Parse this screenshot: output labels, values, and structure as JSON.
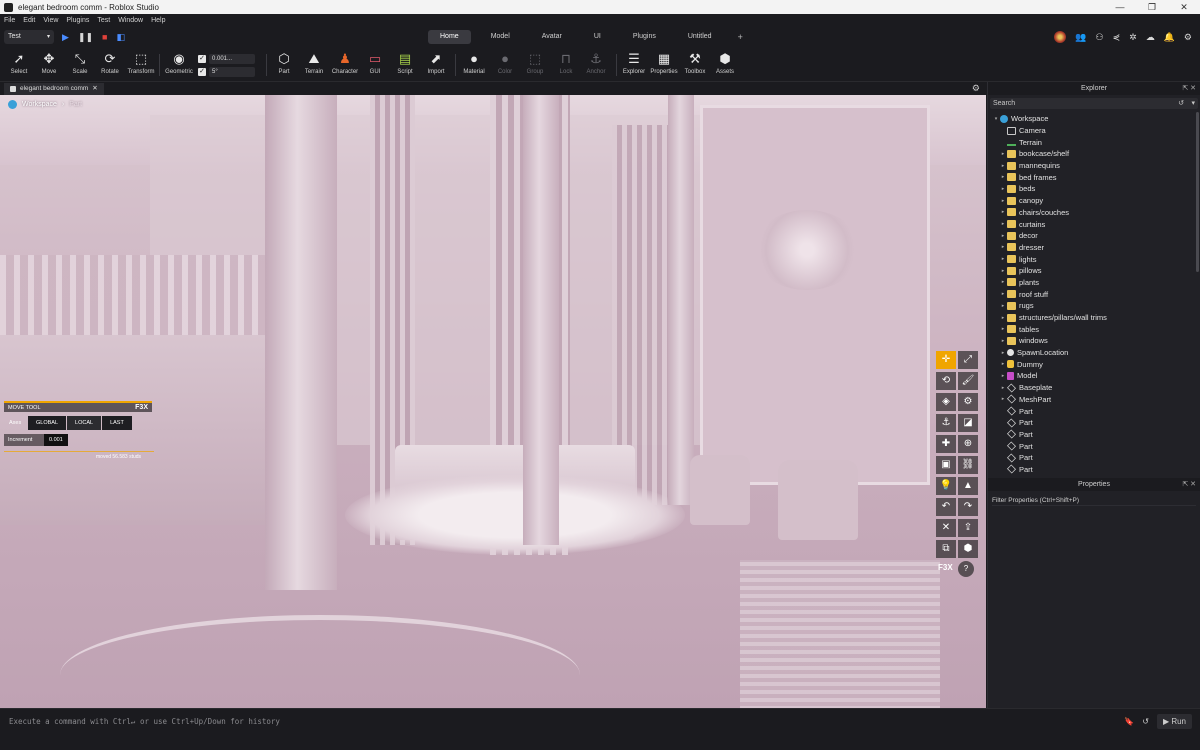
{
  "window": {
    "title": "elegant bedroom comm - Roblox Studio",
    "controls": [
      "—",
      "❐",
      "✕"
    ]
  },
  "menu": [
    "File",
    "Edit",
    "View",
    "Plugins",
    "Test",
    "Window",
    "Help"
  ],
  "quick": {
    "mode": "Test",
    "tabs": [
      {
        "label": "Home",
        "active": true
      },
      {
        "label": "Model",
        "active": false
      },
      {
        "label": "Avatar",
        "active": false
      },
      {
        "label": "UI",
        "active": false
      },
      {
        "label": "Plugins",
        "active": false
      },
      {
        "label": "Untitled",
        "active": false
      }
    ],
    "add_tab": "+"
  },
  "toolbar": {
    "tools": [
      {
        "label": "Select",
        "icon": "cursor-icon",
        "glyph": "➚"
      },
      {
        "label": "Move",
        "icon": "move-icon",
        "glyph": "✥"
      },
      {
        "label": "Scale",
        "icon": "scale-icon",
        "glyph": "⤡"
      },
      {
        "label": "Rotate",
        "icon": "rotate-icon",
        "glyph": "⟳"
      },
      {
        "label": "Transform",
        "icon": "transform-icon",
        "glyph": "⬚"
      },
      {
        "label": "Geometric",
        "icon": "geometric-icon",
        "glyph": "◉"
      }
    ],
    "snap_move": "0.001...",
    "snap_rotate": "5°",
    "insert": [
      {
        "label": "Part",
        "icon": "part-icon",
        "glyph": "⬡"
      },
      {
        "label": "Terrain",
        "icon": "terrain-icon",
        "glyph": "⛰"
      },
      {
        "label": "Character",
        "icon": "character-icon",
        "glyph": "♟"
      },
      {
        "label": "GUI",
        "icon": "gui-icon",
        "glyph": "▭"
      },
      {
        "label": "Script",
        "icon": "script-icon",
        "glyph": "▤"
      },
      {
        "label": "Import",
        "icon": "import-icon",
        "glyph": "⬈"
      }
    ],
    "appearance": [
      {
        "label": "Material",
        "icon": "material-icon",
        "glyph": "●",
        "dim": false
      },
      {
        "label": "Color",
        "icon": "color-icon",
        "glyph": "●",
        "dim": true
      },
      {
        "label": "Group",
        "icon": "group-icon",
        "glyph": "⬚",
        "dim": true
      },
      {
        "label": "Lock",
        "icon": "lock-icon",
        "glyph": "🔒",
        "dim": true
      },
      {
        "label": "Anchor",
        "icon": "anchor-icon",
        "glyph": "⚓",
        "dim": true
      }
    ],
    "panels": [
      {
        "label": "Explorer",
        "icon": "explorer-icon",
        "glyph": "☰"
      },
      {
        "label": "Properties",
        "icon": "properties-icon",
        "glyph": "▦"
      },
      {
        "label": "Toolbox",
        "icon": "toolbox-icon",
        "glyph": "⚒"
      },
      {
        "label": "Assets",
        "icon": "assets-icon",
        "glyph": "⬢"
      }
    ]
  },
  "document": {
    "tab": "elegant bedroom comm",
    "close": "✕"
  },
  "viewport": {
    "breadcrumb": {
      "root": "Workspace",
      "child": "Part"
    }
  },
  "f3x": {
    "title": "MOVE TOOL",
    "brand": "F3X",
    "axes_label": "Axes",
    "axes": [
      "GLOBAL",
      "LOCAL",
      "LAST"
    ],
    "increment_label": "Increment",
    "increment_value": "0.001",
    "moved_note": "moved 56.583 studs",
    "dock_brand": "F3X"
  },
  "explorer": {
    "title": "Explorer",
    "search_placeholder": "Search",
    "items": [
      {
        "label": "Workspace",
        "icon": "world",
        "depth": 0,
        "twisty": "▾"
      },
      {
        "label": "Camera",
        "icon": "camera",
        "depth": 1,
        "twisty": ""
      },
      {
        "label": "Terrain",
        "icon": "terrain",
        "depth": 1,
        "twisty": ""
      },
      {
        "label": "bookcase/shelf",
        "icon": "folder",
        "depth": 1,
        "twisty": "▸"
      },
      {
        "label": "mannequins",
        "icon": "folder",
        "depth": 1,
        "twisty": "▸"
      },
      {
        "label": "bed frames",
        "icon": "folder",
        "depth": 1,
        "twisty": "▸"
      },
      {
        "label": "beds",
        "icon": "folder",
        "depth": 1,
        "twisty": "▸"
      },
      {
        "label": "canopy",
        "icon": "folder",
        "depth": 1,
        "twisty": "▸"
      },
      {
        "label": "chairs/couches",
        "icon": "folder",
        "depth": 1,
        "twisty": "▸"
      },
      {
        "label": "curtains",
        "icon": "folder",
        "depth": 1,
        "twisty": "▸"
      },
      {
        "label": "decor",
        "icon": "folder",
        "depth": 1,
        "twisty": "▸"
      },
      {
        "label": "dresser",
        "icon": "folder",
        "depth": 1,
        "twisty": "▸"
      },
      {
        "label": "lights",
        "icon": "folder",
        "depth": 1,
        "twisty": "▸"
      },
      {
        "label": "pillows",
        "icon": "folder",
        "depth": 1,
        "twisty": "▸"
      },
      {
        "label": "plants",
        "icon": "folder",
        "depth": 1,
        "twisty": "▸"
      },
      {
        "label": "roof stuff",
        "icon": "folder",
        "depth": 1,
        "twisty": "▸"
      },
      {
        "label": "rugs",
        "icon": "folder",
        "depth": 1,
        "twisty": "▸"
      },
      {
        "label": "structures/pillars/wall trims",
        "icon": "folder",
        "depth": 1,
        "twisty": "▸"
      },
      {
        "label": "tables",
        "icon": "folder",
        "depth": 1,
        "twisty": "▸"
      },
      {
        "label": "windows",
        "icon": "folder",
        "depth": 1,
        "twisty": "▸"
      },
      {
        "label": "SpawnLocation",
        "icon": "spawn",
        "depth": 1,
        "twisty": "▸"
      },
      {
        "label": "Dummy",
        "icon": "dummy",
        "depth": 1,
        "twisty": "▸"
      },
      {
        "label": "Model",
        "icon": "model",
        "depth": 1,
        "twisty": "▸"
      },
      {
        "label": "Baseplate",
        "icon": "part",
        "depth": 1,
        "twisty": "▸"
      },
      {
        "label": "MeshPart",
        "icon": "part",
        "depth": 1,
        "twisty": "▸"
      },
      {
        "label": "Part",
        "icon": "part",
        "depth": 1,
        "twisty": ""
      },
      {
        "label": "Part",
        "icon": "part",
        "depth": 1,
        "twisty": ""
      },
      {
        "label": "Part",
        "icon": "part",
        "depth": 1,
        "twisty": ""
      },
      {
        "label": "Part",
        "icon": "part",
        "depth": 1,
        "twisty": ""
      },
      {
        "label": "Part",
        "icon": "part",
        "depth": 1,
        "twisty": ""
      },
      {
        "label": "Part",
        "icon": "part",
        "depth": 1,
        "twisty": ""
      }
    ]
  },
  "properties": {
    "title": "Properties",
    "filter_placeholder": "Filter Properties (Ctrl+Shift+P)"
  },
  "command": {
    "placeholder": "Execute a command with Ctrl↵ or use Ctrl+Up/Down for history",
    "run": "Run"
  },
  "colors": {
    "accent": "#f0a500",
    "panel_bg": "#212126",
    "chrome_bg": "#1b1b1f",
    "scene_tint": "#cfb7c4"
  }
}
